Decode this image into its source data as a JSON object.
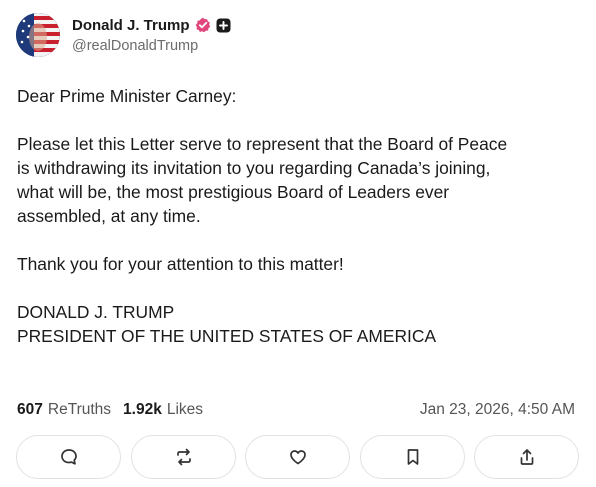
{
  "author": {
    "display_name": "Donald J. Trump",
    "handle": "@realDonaldTrump",
    "verified_color": "#e0457b"
  },
  "post": {
    "paragraphs": [
      [
        "Dear Prime Minister Carney:"
      ],
      [
        "Please let this Letter serve to represent that the Board of Peace",
        "is withdrawing its invitation to you regarding Canada’s joining,",
        "what will be, the most prestigious Board of Leaders ever",
        "assembled, at any time."
      ],
      [
        "Thank you for your attention to this matter!"
      ],
      [
        "DONALD J. TRUMP",
        "PRESIDENT OF THE UNITED STATES OF AMERICA"
      ]
    ]
  },
  "stats": {
    "retruths_count": "607",
    "retruths_label": "ReTruths",
    "likes_count": "1.92k",
    "likes_label": "Likes",
    "timestamp": "Jan 23, 2026, 4:50 AM"
  },
  "actions": {
    "icons": [
      "reply-icon",
      "retruth-icon",
      "like-icon",
      "bookmark-icon",
      "share-icon"
    ]
  }
}
